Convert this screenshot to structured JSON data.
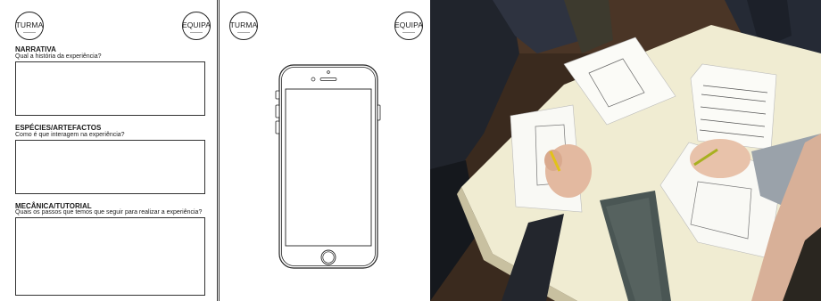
{
  "left_sheet": {
    "turma_label": "TURMA",
    "equipa_label": "EQUIPA",
    "sections": [
      {
        "title": "NARRATIVA",
        "prompt": "Qual a história da experiência?"
      },
      {
        "title": "ESPÉCIES/ARTEFACTOS",
        "prompt": "Como é que interagem na experiência?"
      },
      {
        "title": "MECÂNICA/TUTORIAL",
        "prompt": "Quais os passos que temos que seguir para realizar a experiência?"
      }
    ]
  },
  "phone_sheet": {
    "turma_label": "TURMA",
    "equipa_label": "EQUIPA",
    "device_icon": "smartphone-outline"
  },
  "photo": {
    "subject": "hands-sketching-on-printed-templates"
  },
  "colors": {
    "table": "#f0ecd2",
    "pouch": "#4a5654",
    "pencil": "#e2c21a"
  }
}
